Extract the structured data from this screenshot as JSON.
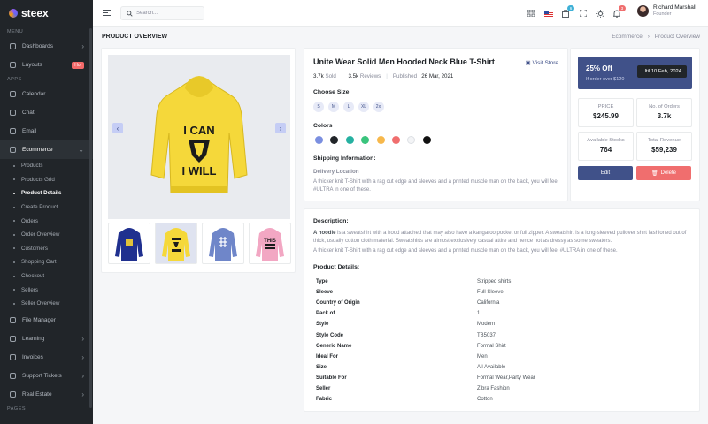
{
  "sidebar": {
    "brand": "steex",
    "sections": {
      "menu": "MENU",
      "apps": "APPS",
      "pages": "PAGES"
    },
    "items": {
      "dashboards": "Dashboards",
      "layouts": "Layouts",
      "layouts_badge": "Hot",
      "calendar": "Calendar",
      "chat": "Chat",
      "email": "Email",
      "ecommerce": "Ecommerce",
      "file_manager": "File Manager",
      "learning": "Learning",
      "invoices": "Invoices",
      "support_tickets": "Support Tickets",
      "real_estate": "Real Estate"
    },
    "ecommerce_sub": [
      "Products",
      "Products Grid",
      "Product Details",
      "Create Product",
      "Orders",
      "Order Overview",
      "Customers",
      "Shopping Cart",
      "Checkout",
      "Sellers",
      "Seller Overview"
    ]
  },
  "topbar": {
    "search_placeholder": "Search...",
    "cart_count": "6",
    "notif_count": "3",
    "user_name": "Richard Marshall",
    "user_role": "Founder"
  },
  "page": {
    "title": "PRODUCT OVERVIEW",
    "breadcrumb_parent": "Ecommerce",
    "breadcrumb_sep": "›",
    "breadcrumb_current": "Product Overview"
  },
  "product": {
    "name": "Unite Wear Solid Men Hooded Neck Blue T-Shirt",
    "visit_store": "Visit Store",
    "sold_value": "3.7k",
    "sold_label": "Sold",
    "reviews_value": "3.5k",
    "reviews_label": "Reviews",
    "published_label": "Published :",
    "published_date": "26 Mar, 2021",
    "size_label": "Choose Size:",
    "sizes": [
      "S",
      "M",
      "L",
      "XL",
      "2xl"
    ],
    "colors_label": "Colors :",
    "colors": [
      "#7b8fe0",
      "#212529",
      "#26b1a1",
      "#3ac47d",
      "#f7b84b",
      "#f06e6e",
      "#f3f4f6",
      "#111111"
    ],
    "shipping_label": "Shipping Information:",
    "delivery_label": "Delivery Location",
    "shipping_text": "A thicker knit T-Shirt with a rag cut edge and sleeves and a printed muscle man on the back, you will feel #ULTRA in one of these."
  },
  "promo": {
    "title": "25% Off",
    "subtitle": "If order over $120",
    "date": "Util 10 Feb, 2024"
  },
  "stats": {
    "price_label": "PRICE",
    "price": "$245.99",
    "orders_label": "No. of Orders",
    "orders": "3.7k",
    "stocks_label": "Available Stocks",
    "stocks": "764",
    "revenue_label": "Total Revenue",
    "revenue": "$59,239"
  },
  "actions": {
    "edit": "Edit",
    "delete": "Delete"
  },
  "description": {
    "title": "Description:",
    "p1_bold": "A hoodie",
    "p1_rest": " is a sweatshirt with a hood attached that may also have a kangaroo pocket or full zipper. A sweatshirt is a long-sleeved pullover shirt fashioned out of thick, usually cotton cloth material. Sweatshirts are almost exclusively casual attire and hence not as dressy as some sweaters.",
    "p2": "A thicker knit T-Shirt with a rag cut edge and sleeves and a printed muscle man on the back, you will feel #ULTRA in one of these.",
    "details_title": "Product Details:",
    "details": [
      {
        "k": "Type",
        "v": "Stripped shirts"
      },
      {
        "k": "Sleeve",
        "v": "Full Sleeve"
      },
      {
        "k": "Country of Origin",
        "v": "California"
      },
      {
        "k": "Pack of",
        "v": "1"
      },
      {
        "k": "Style",
        "v": "Modern"
      },
      {
        "k": "Style Code",
        "v": "TB5037"
      },
      {
        "k": "Generic Name",
        "v": "Formal Shirt"
      },
      {
        "k": "Ideal For",
        "v": "Men"
      },
      {
        "k": "Size",
        "v": "All Available"
      },
      {
        "k": "Suitable For",
        "v": "Formal Wear,Party Wear"
      },
      {
        "k": "Seller",
        "v": "Zibra Fashion"
      },
      {
        "k": "Fabric",
        "v": "Cotton"
      }
    ]
  },
  "gallery": {
    "main_print_line1": "I CAN",
    "main_print_line2": "I WILL",
    "thumb_print": "THIS"
  }
}
